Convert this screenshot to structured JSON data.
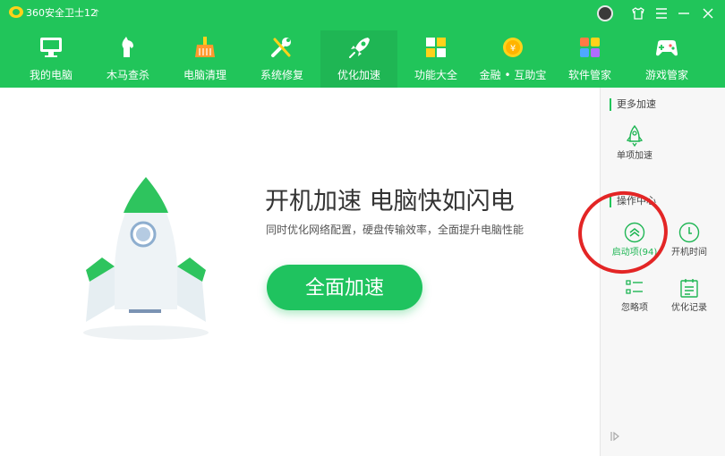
{
  "titlebar": {
    "app_title": "360安全卫士12",
    "upgrade_icon": "upgrade-arrow-icon",
    "controls": [
      "skin-icon",
      "menu-icon",
      "minimize-icon",
      "close-icon"
    ]
  },
  "nav": {
    "items": [
      {
        "label": "我的电脑",
        "icon": "computer-icon"
      },
      {
        "label": "木马查杀",
        "icon": "trojan-horse-icon"
      },
      {
        "label": "电脑清理",
        "icon": "broom-icon"
      },
      {
        "label": "系统修复",
        "icon": "wrench-icon"
      },
      {
        "label": "优化加速",
        "icon": "rocket-icon",
        "active": true
      },
      {
        "label": "功能大全",
        "icon": "grid-icon"
      },
      {
        "label": "金融 • 互助宝",
        "icon": "coin-icon"
      },
      {
        "label": "软件管家",
        "icon": "software-icon"
      },
      {
        "label": "游戏管家",
        "icon": "gamepad-icon"
      }
    ]
  },
  "main": {
    "headline": "开机加速 电脑快如闪电",
    "subtext": "同时优化网络配置，硬盘传输效率，全面提升电脑性能",
    "button_label": "全面加速"
  },
  "sidebar": {
    "more_title": "更多加速",
    "single_label": "单项加速",
    "ops_title": "操作中心",
    "startup_label": "启动项(94)",
    "boot_time_label": "开机时间",
    "ignore_label": "忽略项",
    "log_label": "优化记录"
  },
  "colors": {
    "brand_green": "#21c55a",
    "highlight_red": "#e32525"
  }
}
